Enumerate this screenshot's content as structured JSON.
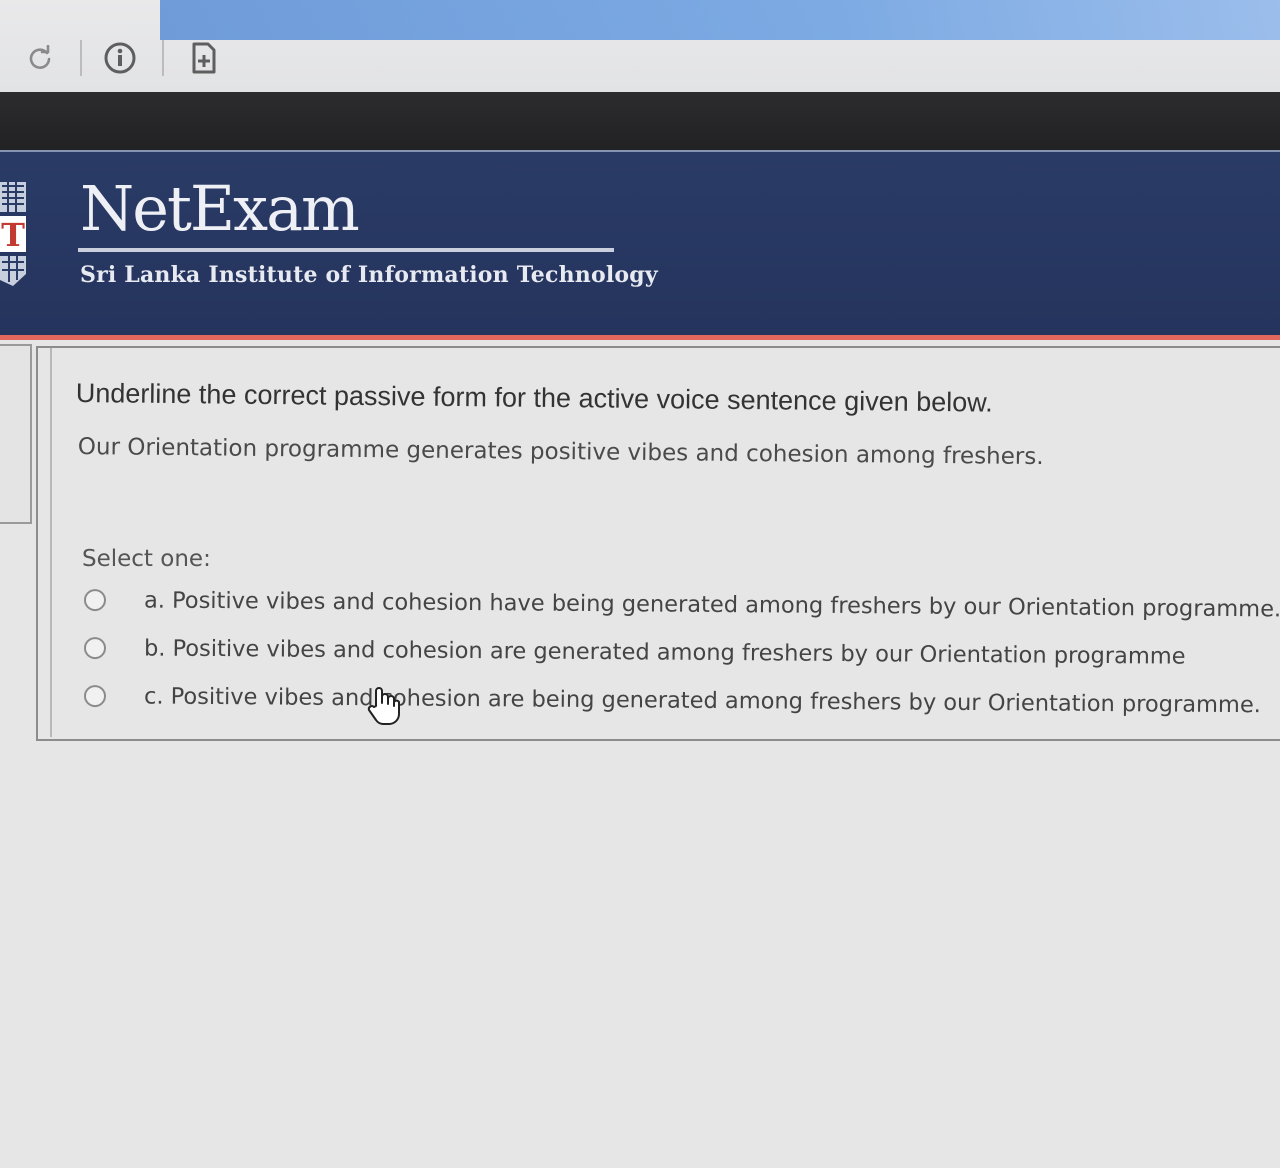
{
  "brand": {
    "name": "NetExam",
    "institute": "Sri Lanka Institute of Information Technology"
  },
  "toolbar": {
    "icons": [
      "reload-icon",
      "info-icon",
      "add-page-icon"
    ]
  },
  "question": {
    "instruction": "Underline the correct passive form for the active voice sentence given below.",
    "sentence": "Our Orientation programme generates positive vibes and cohesion among freshers.",
    "select_label": "Select one:",
    "options": [
      {
        "label": "a. Positive vibes and cohesion have being generated among freshers by our Orientation programme."
      },
      {
        "label": "b. Positive vibes and cohesion  are generated among freshers by our  Orientation programme"
      },
      {
        "label": "c. Positive vibes and cohesion are being generated among freshers by our Orientation programme."
      }
    ]
  },
  "colors": {
    "header_bg": "#2a3b66",
    "header_accent": "#e2675d",
    "page_bg": "#e6e6e6"
  }
}
